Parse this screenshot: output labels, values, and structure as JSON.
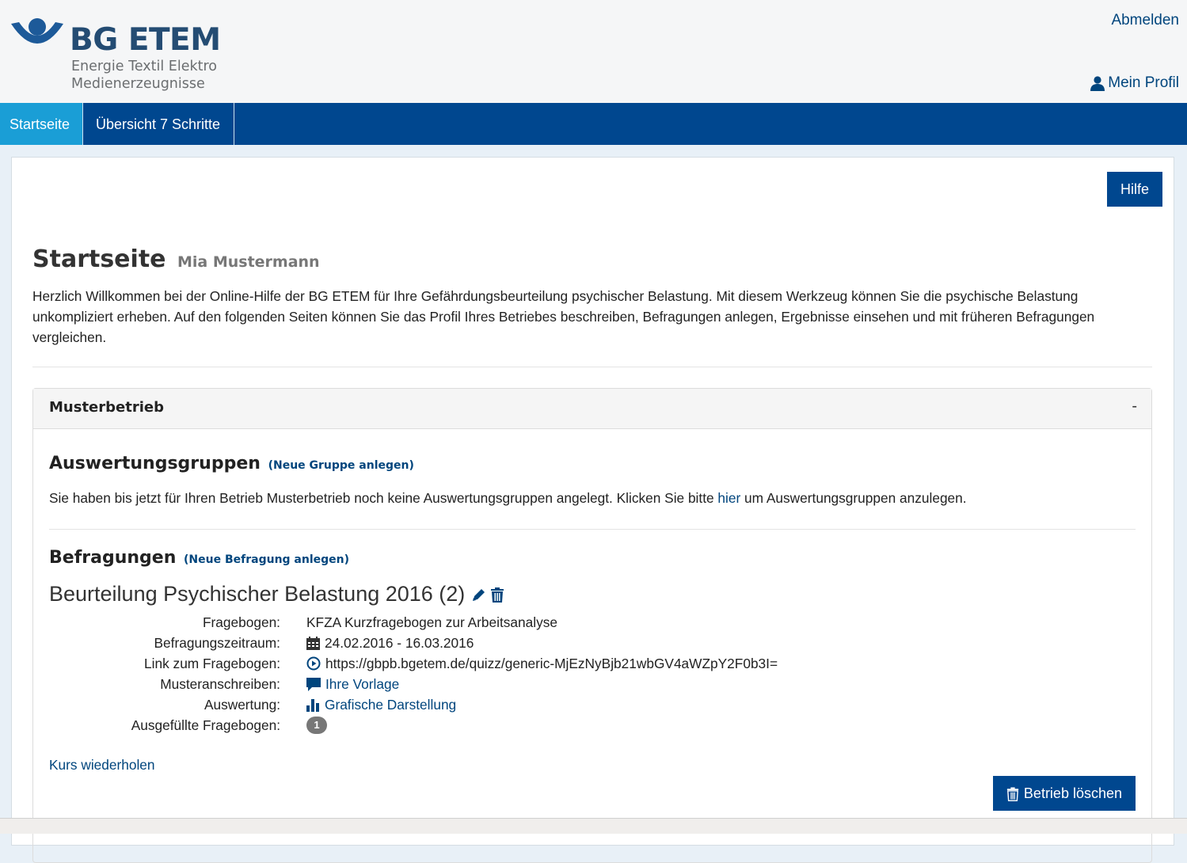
{
  "header": {
    "logo_title": "BG ETEM",
    "logo_sub1": "Energie Textil Elektro",
    "logo_sub2": "Medienerzeugnisse",
    "logout": "Abmelden",
    "profile": "Mein Profil"
  },
  "nav": {
    "items": [
      {
        "label": "Startseite",
        "active": true
      },
      {
        "label": "Übersicht 7 Schritte",
        "active": false
      }
    ]
  },
  "main": {
    "help_button": "Hilfe",
    "title": "Startseite",
    "user_name": "Mia Mustermann",
    "intro": "Herzlich Willkommen bei der Online-Hilfe der BG ETEM für Ihre Gefährdungsbeurteilung psychischer Belastung. Mit diesem Werkzeug können Sie die psychische Belastung unkompliziert erheben. Auf den folgenden Seiten können Sie das Profil Ihres Betriebes beschreiben, Befragungen anlegen, Ergebnisse einsehen und mit früheren Befragungen vergleichen."
  },
  "panel": {
    "title": "Musterbetrieb",
    "toggle": "-",
    "groups": {
      "title": "Auswertungsgruppen",
      "new_link": "(Neue Gruppe anlegen)",
      "text_before": "Sie haben bis jetzt für Ihren Betrieb Musterbetrieb noch keine Auswertungsgruppen angelegt. Klicken Sie bitte ",
      "text_link": "hier",
      "text_after": " um Auswertungsgruppen anzulegen."
    },
    "surveys": {
      "title": "Befragungen",
      "new_link": "(Neue Befragung anlegen)",
      "survey_title": "Beurteilung Psychischer Belastung 2016 (2)",
      "rows": [
        {
          "label": "Fragebogen:",
          "value": "KFZA Kurzfragebogen zur Arbeitsanalyse",
          "icon": "none",
          "link": false
        },
        {
          "label": "Befragungszeitraum:",
          "value": "24.02.2016 - 16.03.2016",
          "icon": "calendar-icon",
          "link": false
        },
        {
          "label": "Link zum Fragebogen:",
          "value": "https://gbpb.bgetem.de/quizz/generic-MjEzNyBjb21wbGV4aWZpY2F0b3I=",
          "icon": "play-circle-icon",
          "link": false
        },
        {
          "label": "Musteranschreiben:",
          "value": "Ihre Vorlage",
          "icon": "comment-icon",
          "link": true
        },
        {
          "label": "Auswertung:",
          "value": "Grafische Darstellung",
          "icon": "bar-chart-icon",
          "link": true
        },
        {
          "label": "Ausgefüllte Fragebogen:",
          "value": "1",
          "icon": "badge",
          "link": false
        }
      ]
    },
    "course_link": "Kurs wiederholen",
    "delete_button": "Betrieb löschen"
  },
  "colors": {
    "nav_bg": "#00478f",
    "nav_active": "#1a9ed6",
    "link": "#00457d",
    "logo_blue": "#1d5a99"
  }
}
